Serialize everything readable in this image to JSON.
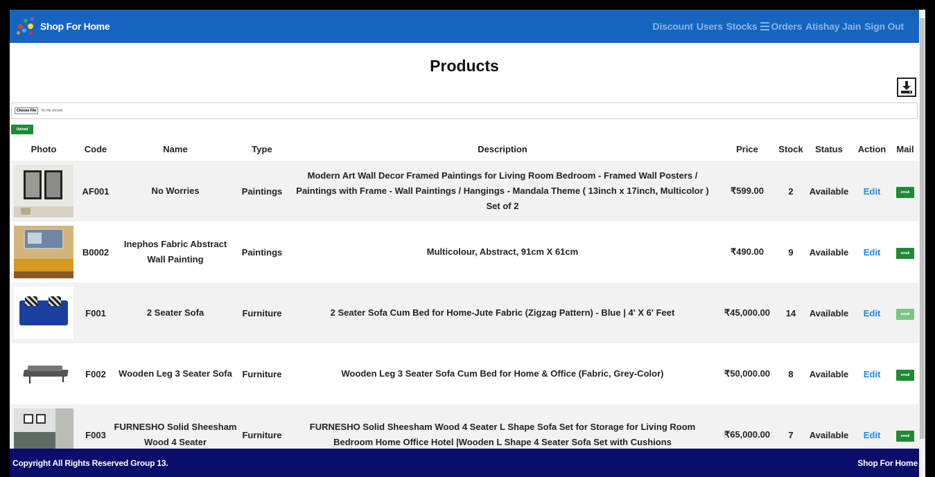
{
  "navbar": {
    "brand": "Shop For Home",
    "links": [
      "Discount",
      "Users",
      "Stocks"
    ],
    "orders_label": "Orders",
    "user_name": "Atishay Jain",
    "signout_label": "Sign Out"
  },
  "page_title": "Products",
  "upload": {
    "choose_label": "Choose File",
    "no_file_text": "No file chosen",
    "upload_label": "Upload"
  },
  "table": {
    "headers": [
      "Photo",
      "Code",
      "Name",
      "Type",
      "Description",
      "Price",
      "Stock",
      "Status",
      "Action",
      "Mail"
    ],
    "rows": [
      {
        "code": "AF001",
        "name": "No Worries",
        "type": "Paintings",
        "description": "Modern Art Wall Decor Framed Paintings for Living Room Bedroom - Framed Wall Posters / Paintings with Frame - Wall Paintings / Hangings - Mandala Theme ( 13inch x 17inch, Multicolor ) Set of 2",
        "price": "₹599.00",
        "stock": "2",
        "status": "Available",
        "action": "Edit",
        "mail": "email"
      },
      {
        "code": "B0002",
        "name": "Inephos Fabric Abstract Wall Painting",
        "type": "Paintings",
        "description": "Multicolour, Abstract, 91cm X 61cm",
        "price": "₹490.00",
        "stock": "9",
        "status": "Available",
        "action": "Edit",
        "mail": "email"
      },
      {
        "code": "F001",
        "name": "2 Seater Sofa",
        "type": "Furniture",
        "description": "2 Seater Sofa Cum Bed for Home-Jute Fabric (Zigzag Pattern) - Blue | 4' X 6' Feet",
        "price": "₹45,000.00",
        "stock": "14",
        "status": "Available",
        "action": "Edit",
        "mail": "email"
      },
      {
        "code": "F002",
        "name": "Wooden Leg 3 Seater Sofa",
        "type": "Furniture",
        "description": "Wooden Leg 3 Seater Sofa Cum Bed for Home & Office (Fabric, Grey-Color)",
        "price": "₹50,000.00",
        "stock": "8",
        "status": "Available",
        "action": "Edit",
        "mail": "email"
      },
      {
        "code": "F003",
        "name": "FURNESHO Solid Sheesham Wood 4 Seater",
        "type": "Furniture",
        "description": "FURNESHO Solid Sheesham Wood 4 Seater L Shape Sofa Set for Storage for Living Room Bedroom Home Office Hotel |Wooden L Shape 4 Seater Sofa Set with Cushions",
        "price": "₹65,000.00",
        "stock": "7",
        "status": "Available",
        "action": "Edit",
        "mail": "email"
      }
    ]
  },
  "footer": {
    "copyright": "Copyright All Rights Reserved Group 13.",
    "brand": "Shop For Home"
  },
  "colors": {
    "navbar": "#1565c0",
    "footer": "#0b0d6b",
    "mail_button": "#1e8a35",
    "edit_link": "#1e88e5"
  },
  "icons": {
    "download": "download-icon",
    "orders": "list-icon",
    "logo": "logo-icon"
  }
}
